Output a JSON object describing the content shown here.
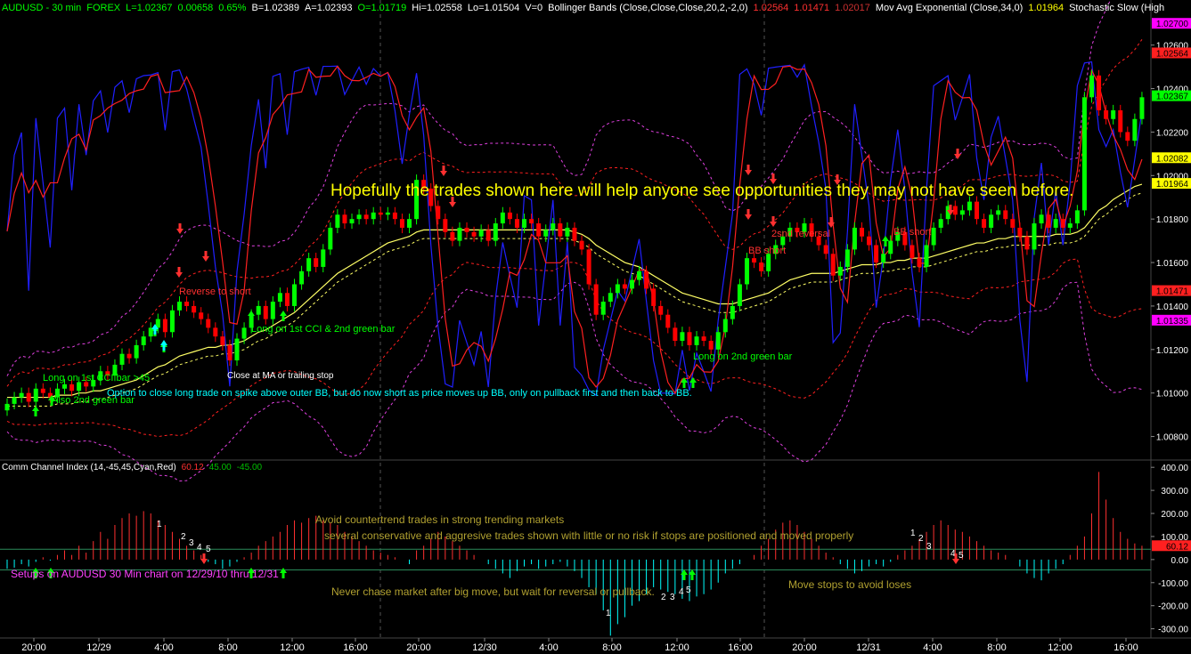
{
  "header": {
    "symbol": "AUDUSD - 30 min",
    "market": "FOREX",
    "last": "L=1.02367",
    "change": "0.00658",
    "change_pct": "0.65%",
    "bid": "B=1.02389",
    "ask": "A=1.02393",
    "open": "O=1.01719",
    "high": "Hi=1.02558",
    "low": "Lo=1.01504",
    "volume": "V=0",
    "bb_label": "Bollinger Bands (Close,Close,Close,20,2,-2,0)",
    "bb_upper": "1.02564",
    "bb_lower": "1.01471",
    "bb_mid": "1.02017",
    "ema_label": "Mov Avg Exponential (Close,34,0)",
    "ema_value": "1.01964",
    "stoch_label": "Stochastic Slow (High"
  },
  "indicator_header": {
    "label": "Comm Channel Index (14,-45,45,Cyan,Red)",
    "value": "60.12",
    "upper": "45.00",
    "lower": "-45.00"
  },
  "colors": {
    "background": "#000000",
    "bull": "#00ff00",
    "bear": "#ff0000",
    "bb_bands": "#ff2020",
    "outer_bb": "#e040e0",
    "ema": "#ffff66",
    "stoch_k": "#2020ff",
    "stoch_d": "#ff2020",
    "cci_pos": "#ff3030",
    "cci_neg": "#00ffff",
    "annotation_green": "#00ff00",
    "annotation_red": "#ff3030",
    "annotation_cyan": "#00ffff",
    "annotation_olive": "#b0a030"
  },
  "annotations": {
    "main": "Hopefully the trades shown here will help anyone see opportunities they may not have seen before.",
    "long_1st_cci": "Long on 1st CCI bar >45",
    "also_2nd": "Also 2nd green bar",
    "option_close": "Option to close long trade on spike above outer BB, but do now short as price moves up BB, only on pullback first and then back to BB.",
    "reverse_short": "Reverse to short",
    "long_cci_2nd": "Long on 1st CCI & 2nd green bar",
    "close_ma": "Close at MA or trailing stop",
    "long_2nd_green": "Long on 2nd green bar",
    "second_reversal": "2snd reversal",
    "bb_short_1": "BB short",
    "bb_short_2": "BB short",
    "countertrend": "Avoid countertrend trades in strong trending markets",
    "conservative": "several conservative and aggresive trades shown with little or no risk if stops are positioned and moved properly",
    "setups": "Setups on AUDUSD 30 Min chart on 12/29/10 thru 12/31",
    "never_chase": "Never chase market after big move, but wait for reversal or pullback.",
    "move_stops": "Move stops to avoid loses"
  },
  "chart_data": [
    {
      "type": "candlestick",
      "title": "AUDUSD - 30 min",
      "ylim": [
        1.007,
        1.0275
      ],
      "y_ticks": [
        "1.02600",
        "1.02400",
        "1.02200",
        "1.02000",
        "1.01800",
        "1.01600",
        "1.01400",
        "1.01200",
        "1.01000",
        "1.00800"
      ],
      "y_tick_values": [
        1.026,
        1.024,
        1.022,
        1.02,
        1.018,
        1.016,
        1.014,
        1.012,
        1.01,
        1.008
      ],
      "x_ticks": [
        "20:00",
        "12/29",
        "4:00",
        "8:00",
        "12:00",
        "16:00",
        "20:00",
        "12/30",
        "4:00",
        "8:00",
        "12:00",
        "16:00",
        "20:00",
        "12/31",
        "4:00",
        "8:00",
        "12:00",
        "16:00"
      ],
      "price_tags": [
        {
          "label": "1.02700",
          "value": 1.027,
          "color": "#ff00ff"
        },
        {
          "label": "1.02564",
          "value": 1.02564,
          "color": "#ff2020"
        },
        {
          "label": "1.02367",
          "value": 1.02367,
          "color": "#00ff00"
        },
        {
          "label": "1.02082",
          "value": 1.02082,
          "color": "#ffff00"
        },
        {
          "label": "1.01964",
          "value": 1.01964,
          "color": "#ffff00"
        },
        {
          "label": "1.01471",
          "value": 1.01471,
          "color": "#ff2020"
        },
        {
          "label": "1.01335",
          "value": 1.01335,
          "color": "#ff00ff"
        }
      ],
      "close": [
        1.0095,
        1.0098,
        1.01,
        1.0096,
        1.0102,
        1.01,
        1.0098,
        1.0102,
        1.0104,
        1.0101,
        1.0105,
        1.0103,
        1.0106,
        1.011,
        1.0108,
        1.0113,
        1.0118,
        1.0116,
        1.0122,
        1.0126,
        1.013,
        1.0134,
        1.0128,
        1.0138,
        1.0142,
        1.014,
        1.0137,
        1.0134,
        1.013,
        1.0126,
        1.0122,
        1.0115,
        1.0125,
        1.013,
        1.0136,
        1.014,
        1.0134,
        1.0142,
        1.0146,
        1.014,
        1.015,
        1.0156,
        1.0162,
        1.0158,
        1.0166,
        1.0176,
        1.0182,
        1.0178,
        1.018,
        1.0182,
        1.018,
        1.0183,
        1.0182,
        1.0183,
        1.018,
        1.0176,
        1.018,
        1.0198,
        1.0194,
        1.0186,
        1.018,
        1.0174,
        1.017,
        1.0176,
        1.0174,
        1.0172,
        1.0175,
        1.017,
        1.0178,
        1.0183,
        1.018,
        1.0176,
        1.018,
        1.0178,
        1.0172,
        1.0175,
        1.0178,
        1.0172,
        1.0176,
        1.017,
        1.0166,
        1.015,
        1.0136,
        1.0142,
        1.0146,
        1.015,
        1.0148,
        1.0152,
        1.0156,
        1.0148,
        1.014,
        1.0136,
        1.013,
        1.0124,
        1.0128,
        1.0122,
        1.0126,
        1.0124,
        1.012,
        1.0128,
        1.0134,
        1.014,
        1.015,
        1.0162,
        1.016,
        1.0156,
        1.0164,
        1.0168,
        1.0172,
        1.0176,
        1.0174,
        1.0178,
        1.0172,
        1.0168,
        1.0164,
        1.0154,
        1.0158,
        1.0166,
        1.0176,
        1.0172,
        1.0168,
        1.016,
        1.0164,
        1.017,
        1.0174,
        1.0168,
        1.0162,
        1.0158,
        1.0168,
        1.0176,
        1.018,
        1.0186,
        1.0182,
        1.0184,
        1.0188,
        1.018,
        1.0176,
        1.0182,
        1.0184,
        1.018,
        1.0176,
        1.0172,
        1.0166,
        1.0178,
        1.0182,
        1.0176,
        1.018,
        1.0176,
        1.0178,
        1.0184,
        1.0236,
        1.0246,
        1.023,
        1.0226,
        1.023,
        1.022,
        1.0216,
        1.0226,
        1.0236
      ],
      "ema_34": [
        1.0098,
        1.0098,
        1.0098,
        1.0098,
        1.0098,
        1.0098,
        1.0098,
        1.0099,
        1.0099,
        1.0099,
        1.01,
        1.01,
        1.0101,
        1.0101,
        1.0102,
        1.0103,
        1.0104,
        1.0105,
        1.0106,
        1.0108,
        1.011,
        1.0112,
        1.0113,
        1.0115,
        1.0117,
        1.0118,
        1.0119,
        1.012,
        1.0121,
        1.0121,
        1.0122,
        1.0122,
        1.0123,
        1.0124,
        1.0126,
        1.0128,
        1.0129,
        1.0131,
        1.0133,
        1.0135,
        1.0137,
        1.014,
        1.0143,
        1.0146,
        1.0149,
        1.0152,
        1.0155,
        1.0157,
        1.0159,
        1.0161,
        1.0163,
        1.0165,
        1.0167,
        1.0169,
        1.017,
        1.0171,
        1.0172,
        1.0174,
        1.0175,
        1.0175,
        1.0175,
        1.0175,
        1.0175,
        1.0175,
        1.0175,
        1.0175,
        1.0175,
        1.0175,
        1.0175,
        1.0175,
        1.0175,
        1.0175,
        1.0175,
        1.0175,
        1.0175,
        1.0175,
        1.0175,
        1.0175,
        1.0175,
        1.0174,
        1.0173,
        1.0171,
        1.0168,
        1.0166,
        1.0164,
        1.0162,
        1.016,
        1.0159,
        1.0158,
        1.0156,
        1.0154,
        1.0152,
        1.015,
        1.0148,
        1.0146,
        1.0145,
        1.0144,
        1.0143,
        1.0142,
        1.0141,
        1.0141,
        1.0141,
        1.0142,
        1.0143,
        1.0144,
        1.0145,
        1.0146,
        1.0148,
        1.015,
        1.0152,
        1.0153,
        1.0154,
        1.0155,
        1.0155,
        1.0155,
        1.0155,
        1.0156,
        1.0157,
        1.0158,
        1.0159,
        1.0159,
        1.0159,
        1.016,
        1.016,
        1.0161,
        1.0161,
        1.0162,
        1.0162,
        1.0162,
        1.0163,
        1.0164,
        1.0165,
        1.0166,
        1.0167,
        1.0168,
        1.0169,
        1.0169,
        1.017,
        1.0171,
        1.0171,
        1.0172,
        1.0172,
        1.0172,
        1.0172,
        1.0172,
        1.0172,
        1.0173,
        1.0173,
        1.0173,
        1.0174,
        1.0176,
        1.018,
        1.0184,
        1.0186,
        1.0189,
        1.0191,
        1.0193,
        1.0195,
        1.0196
      ]
    },
    {
      "type": "bar",
      "title": "Comm Channel Index (14,-45,45,Cyan,Red)",
      "ylim": [
        -340,
        420
      ],
      "y_ticks": [
        "400.00",
        "300.00",
        "200.00",
        "100.00",
        "0.00",
        "-100.00",
        "-200.00",
        "-300.00"
      ],
      "y_tick_values": [
        400,
        300,
        200,
        100,
        0,
        -100,
        -200,
        -300
      ],
      "levels": [
        45,
        -45
      ],
      "tags": [
        {
          "label": "60.12",
          "value": 60.12,
          "color": "#ff2020"
        }
      ],
      "values": [
        -40,
        -35,
        -20,
        -30,
        -10,
        10,
        -5,
        20,
        40,
        20,
        60,
        30,
        80,
        120,
        90,
        150,
        180,
        200,
        190,
        210,
        200,
        170,
        150,
        120,
        90,
        60,
        40,
        20,
        -10,
        -20,
        -40,
        -30,
        -10,
        10,
        30,
        60,
        80,
        100,
        120,
        150,
        170,
        160,
        180,
        190,
        170,
        160,
        150,
        120,
        100,
        80,
        60,
        40,
        30,
        20,
        10,
        0,
        -20,
        40,
        60,
        90,
        120,
        100,
        80,
        60,
        40,
        20,
        0,
        -20,
        -40,
        -60,
        -80,
        -50,
        -30,
        -20,
        -40,
        -30,
        -20,
        -10,
        -30,
        -50,
        -80,
        -120,
        -150,
        -220,
        -330,
        -280,
        -250,
        -200,
        -180,
        -150,
        -120,
        -130,
        -140,
        -150,
        -170,
        -180,
        -160,
        -150,
        -130,
        -100,
        -60,
        -40,
        -20,
        0,
        20,
        60,
        90,
        130,
        160,
        170,
        150,
        120,
        90,
        60,
        30,
        10,
        -20,
        -40,
        -60,
        -50,
        -30,
        -20,
        -30,
        -10,
        20,
        40,
        60,
        90,
        120,
        150,
        170,
        150,
        130,
        120,
        100,
        80,
        60,
        40,
        30,
        20,
        0,
        -30,
        -60,
        -80,
        -90,
        -60,
        -40,
        -20,
        20,
        60,
        100,
        200,
        380,
        260,
        180,
        120,
        90,
        70,
        60
      ]
    }
  ]
}
